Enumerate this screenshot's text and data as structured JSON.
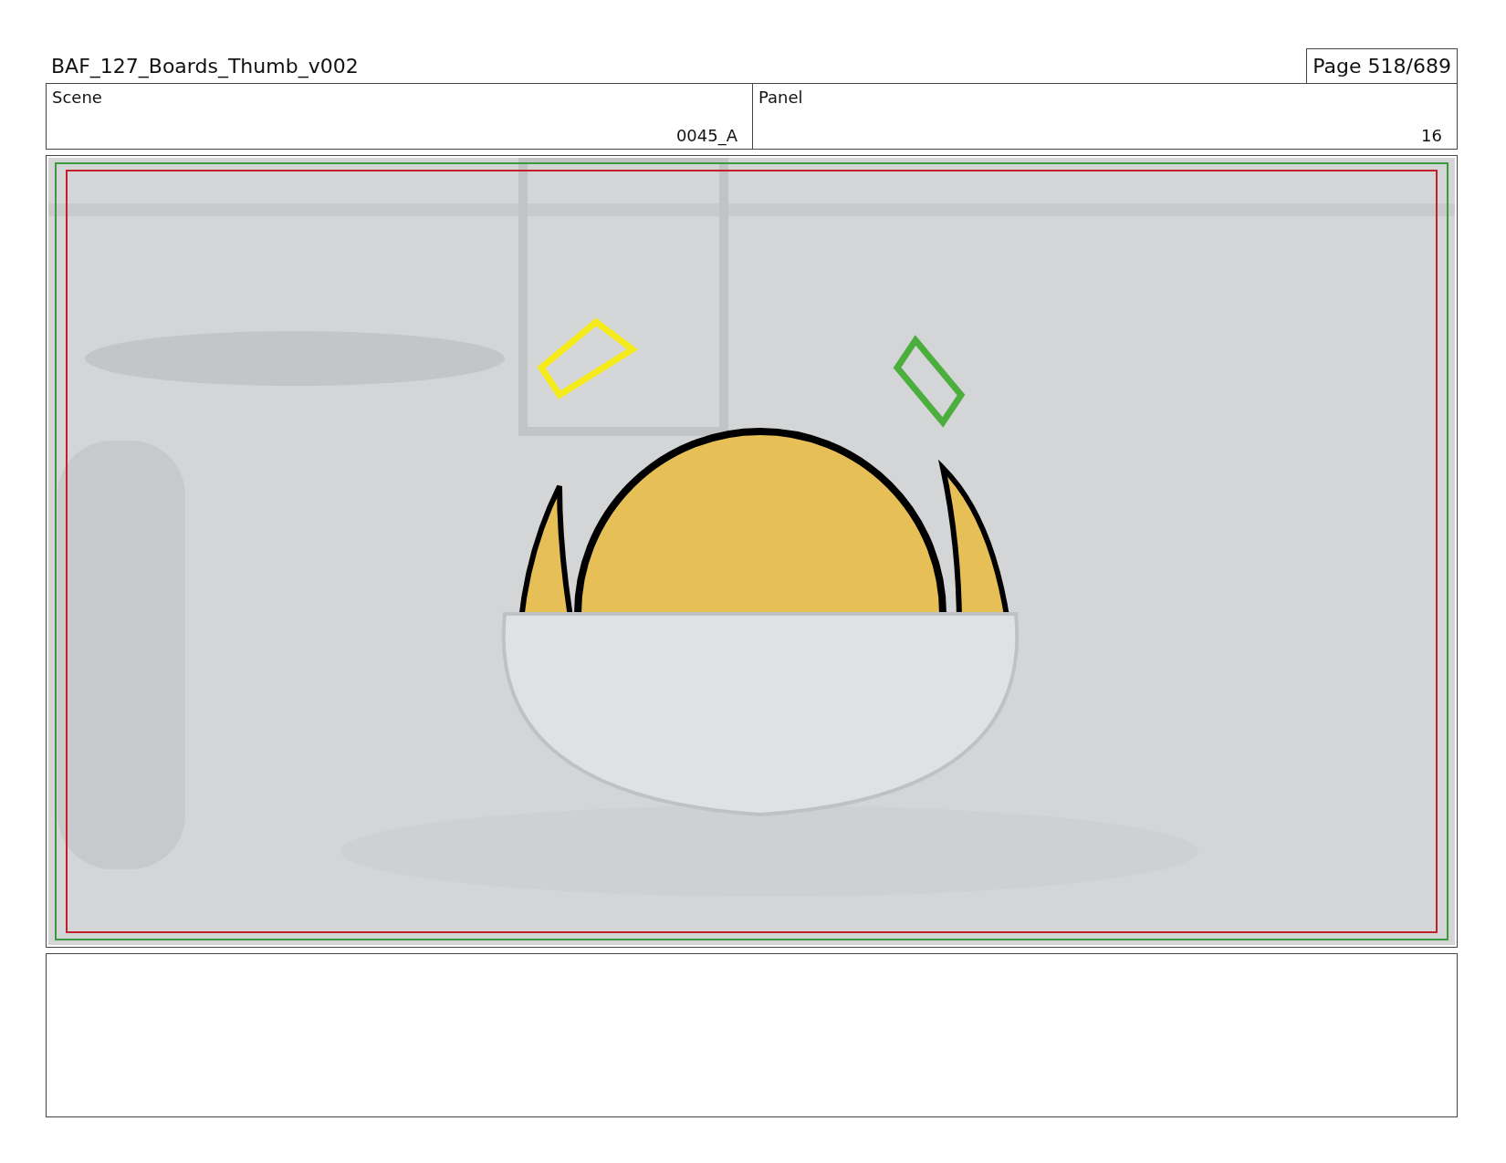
{
  "title": "BAF_127_Boards_Thumb_v002",
  "page": "Page 518/689",
  "fields": [
    {
      "label": "Scene",
      "value": "0045_A"
    },
    {
      "label": "Panel",
      "value": "16"
    }
  ]
}
